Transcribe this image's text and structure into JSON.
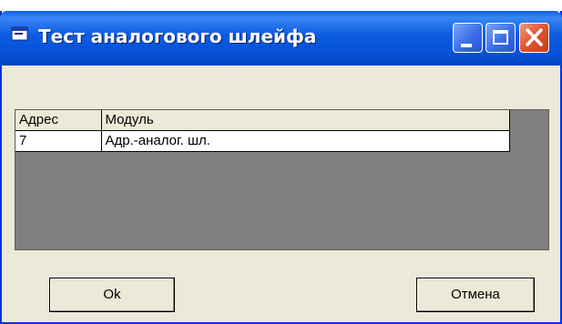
{
  "window": {
    "title": "Тест аналогового шлейфа",
    "icon": "app-window-icon"
  },
  "titlebar_buttons": [
    "minimize-icon",
    "maximize-icon",
    "close-icon"
  ],
  "grid": {
    "columns": [
      "Адрес",
      "Модуль"
    ],
    "rows": [
      [
        "7",
        "Адр.-аналог. шл."
      ]
    ]
  },
  "buttons": {
    "ok_label": "Ok",
    "cancel_label": "Отмена"
  },
  "colors": {
    "titlebar": "#0753d8",
    "close_button": "#e2532e",
    "dialog_face": "#ece9d8",
    "grid_background": "#808080"
  }
}
